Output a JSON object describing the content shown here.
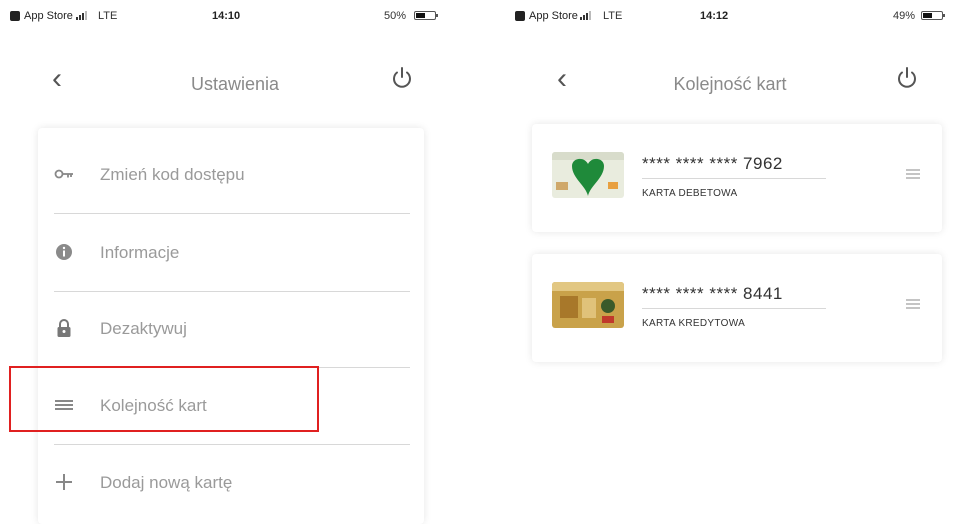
{
  "left": {
    "status": {
      "app": "App Store",
      "network": "LTE",
      "time": "14:10",
      "battery": "50%",
      "battery_level": 0.5
    },
    "nav": {
      "title": "Ustawienia"
    },
    "menu": [
      {
        "label": "Zmień kod dostępu",
        "icon": "key-icon"
      },
      {
        "label": "Informacje",
        "icon": "info-icon"
      },
      {
        "label": "Dezaktywuj",
        "icon": "lock-icon"
      },
      {
        "label": "Kolejność kart",
        "icon": "reorder-icon"
      },
      {
        "label": "Dodaj nową kartę",
        "icon": "plus-icon"
      }
    ],
    "highlight_color": "#e02020"
  },
  "right": {
    "status": {
      "app": "App Store",
      "network": "LTE",
      "time": "14:12",
      "battery": "49%",
      "battery_level": 0.49
    },
    "nav": {
      "title": "Kolejność kart"
    },
    "cards": [
      {
        "number": "**** **** **** 7962",
        "type": "KARTA DEBETOWA",
        "icon": "debit-card-thumbnail"
      },
      {
        "number": "**** **** **** 8441",
        "type": "KARTA KREDYTOWA",
        "icon": "credit-card-thumbnail"
      }
    ]
  },
  "icons": {
    "back": "chevron-left-icon",
    "power": "power-icon",
    "drag": "drag-handle-icon"
  },
  "colors": {
    "accent_red": "#e02020",
    "card_green": "#1f8a3a",
    "card_gold": "#c9a24a"
  }
}
